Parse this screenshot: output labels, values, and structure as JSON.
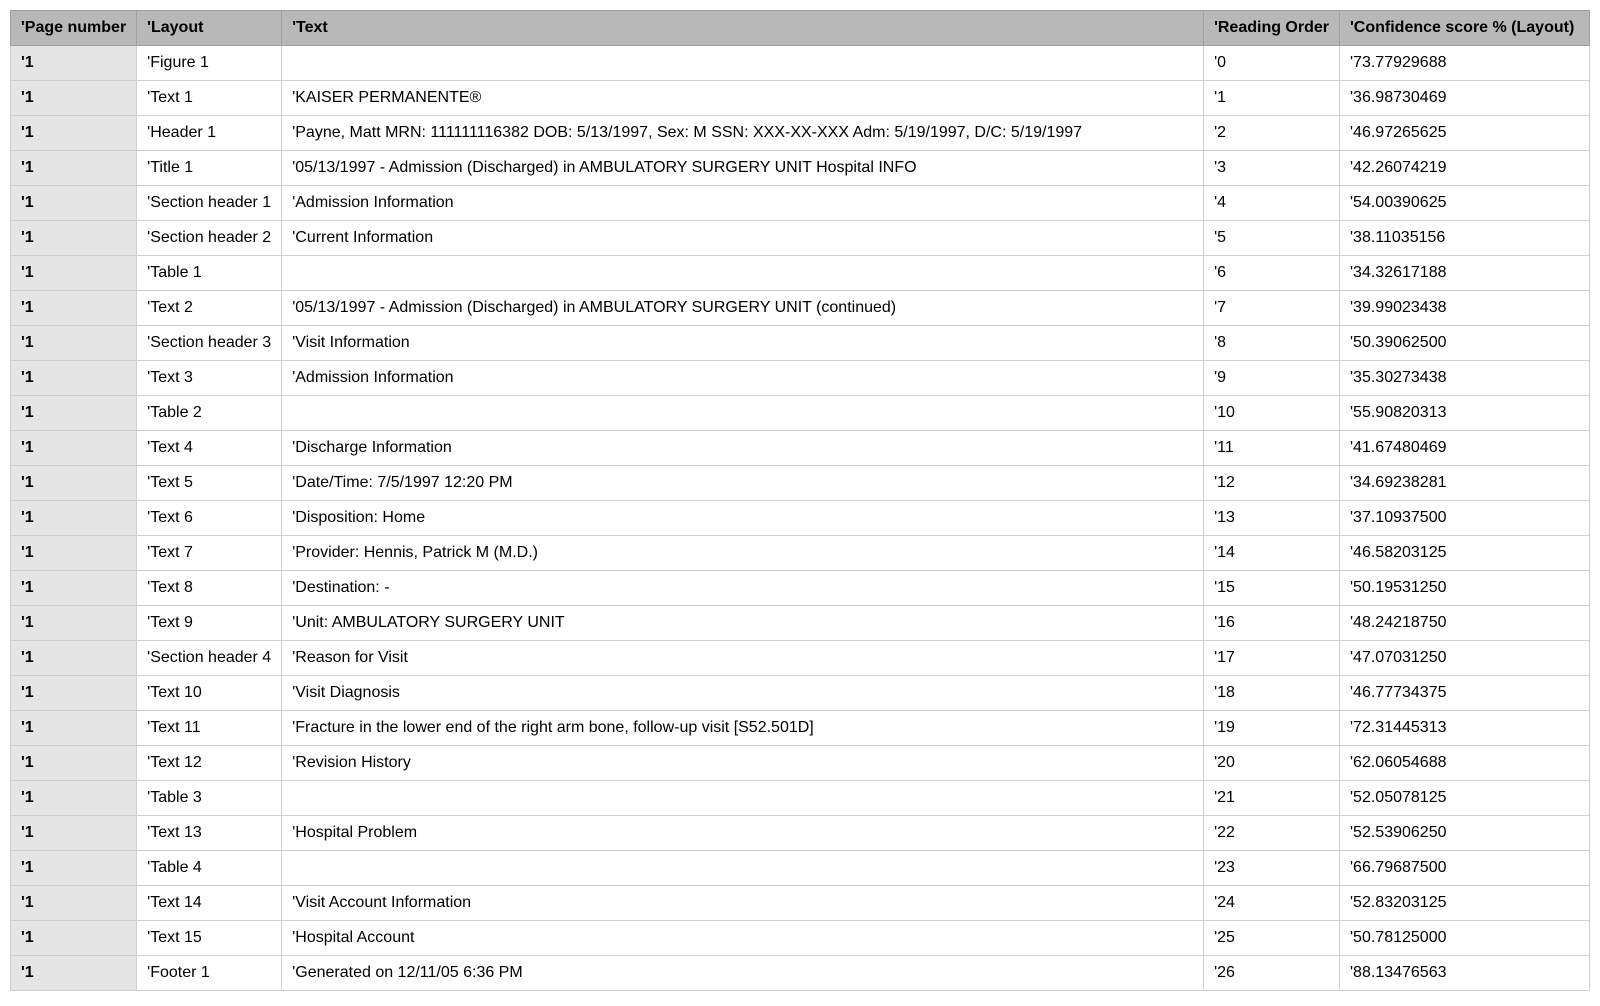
{
  "columns": [
    "'Page number",
    "'Layout",
    "'Text",
    "'Reading Order",
    "'Confidence score % (Layout)"
  ],
  "rows": [
    {
      "page": "'1",
      "layout": "'Figure 1",
      "text": "",
      "order": "'0",
      "conf": "'73.77929688"
    },
    {
      "page": "'1",
      "layout": "'Text 1",
      "text": "'KAISER PERMANENTE®",
      "order": "'1",
      "conf": "'36.98730469"
    },
    {
      "page": "'1",
      "layout": "'Header 1",
      "text": "'Payne, Matt MRN: 111111116382 DOB: 5/13/1997, Sex: M SSN: XXX-XX-XXX Adm: 5/19/1997, D/C: 5/19/1997",
      "order": "'2",
      "conf": "'46.97265625"
    },
    {
      "page": "'1",
      "layout": "'Title 1",
      "text": "'05/13/1997 - Admission (Discharged) in AMBULATORY SURGERY UNIT Hospital INFO",
      "order": "'3",
      "conf": "'42.26074219"
    },
    {
      "page": "'1",
      "layout": "'Section header 1",
      "text": "'Admission Information",
      "order": "'4",
      "conf": "'54.00390625"
    },
    {
      "page": "'1",
      "layout": "'Section header 2",
      "text": "'Current Information",
      "order": "'5",
      "conf": "'38.11035156"
    },
    {
      "page": "'1",
      "layout": "'Table 1",
      "text": "",
      "order": "'6",
      "conf": "'34.32617188"
    },
    {
      "page": "'1",
      "layout": "'Text 2",
      "text": "'05/13/1997 - Admission (Discharged) in AMBULATORY SURGERY UNIT (continued)",
      "order": "'7",
      "conf": "'39.99023438"
    },
    {
      "page": "'1",
      "layout": "'Section header 3",
      "text": "'Visit Information",
      "order": "'8",
      "conf": "'50.39062500"
    },
    {
      "page": "'1",
      "layout": "'Text 3",
      "text": "'Admission Information",
      "order": "'9",
      "conf": "'35.30273438"
    },
    {
      "page": "'1",
      "layout": "'Table 2",
      "text": "",
      "order": "'10",
      "conf": "'55.90820313"
    },
    {
      "page": "'1",
      "layout": "'Text 4",
      "text": "'Discharge Information",
      "order": "'11",
      "conf": "'41.67480469"
    },
    {
      "page": "'1",
      "layout": "'Text 5",
      "text": "'Date/Time: 7/5/1997 12:20 PM",
      "order": "'12",
      "conf": "'34.69238281"
    },
    {
      "page": "'1",
      "layout": "'Text 6",
      "text": "'Disposition: Home",
      "order": "'13",
      "conf": "'37.10937500"
    },
    {
      "page": "'1",
      "layout": "'Text 7",
      "text": "'Provider: Hennis, Patrick M (M.D.)",
      "order": "'14",
      "conf": "'46.58203125"
    },
    {
      "page": "'1",
      "layout": "'Text 8",
      "text": "'Destination: -",
      "order": "'15",
      "conf": "'50.19531250"
    },
    {
      "page": "'1",
      "layout": "'Text 9",
      "text": "'Unit: AMBULATORY SURGERY UNIT",
      "order": "'16",
      "conf": "'48.24218750"
    },
    {
      "page": "'1",
      "layout": "'Section header 4",
      "text": "'Reason for Visit",
      "order": "'17",
      "conf": "'47.07031250"
    },
    {
      "page": "'1",
      "layout": "'Text 10",
      "text": "'Visit Diagnosis",
      "order": "'18",
      "conf": "'46.77734375"
    },
    {
      "page": "'1",
      "layout": "'Text 11",
      "text": "'Fracture in the lower end of the right arm bone, follow-up visit [S52.501D]",
      "order": "'19",
      "conf": "'72.31445313"
    },
    {
      "page": "'1",
      "layout": "'Text 12",
      "text": "'Revision History",
      "order": "'20",
      "conf": "'62.06054688"
    },
    {
      "page": "'1",
      "layout": "'Table 3",
      "text": "",
      "order": "'21",
      "conf": "'52.05078125"
    },
    {
      "page": "'1",
      "layout": "'Text 13",
      "text": "'Hospital Problem",
      "order": "'22",
      "conf": "'52.53906250"
    },
    {
      "page": "'1",
      "layout": "'Table 4",
      "text": "",
      "order": "'23",
      "conf": "'66.79687500"
    },
    {
      "page": "'1",
      "layout": "'Text 14",
      "text": "'Visit Account Information",
      "order": "'24",
      "conf": "'52.83203125"
    },
    {
      "page": "'1",
      "layout": "'Text 15",
      "text": "'Hospital Account",
      "order": "'25",
      "conf": "'50.78125000"
    },
    {
      "page": "'1",
      "layout": "'Footer 1",
      "text": "'Generated on 12/11/05 6:36 PM",
      "order": "'26",
      "conf": "'88.13476563"
    }
  ]
}
